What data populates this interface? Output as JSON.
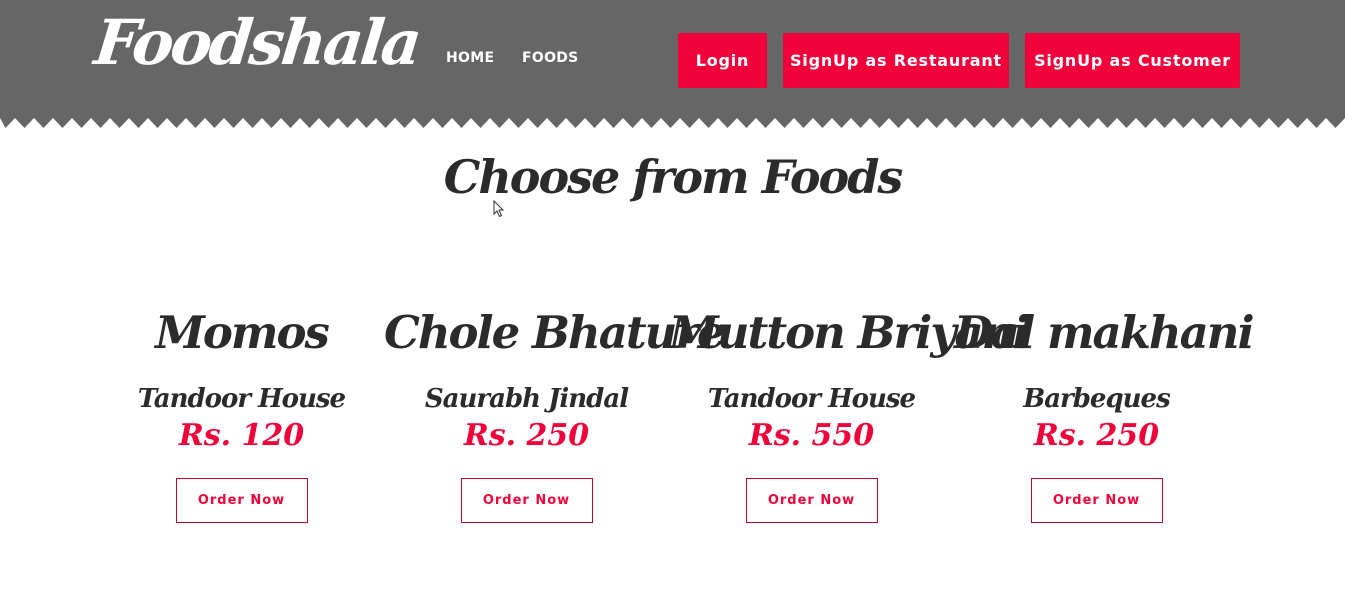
{
  "brand": {
    "logo_text": "Foodshala"
  },
  "nav": {
    "home_label": "HOME",
    "foods_label": "FOODS"
  },
  "header_buttons": {
    "login_label": "Login",
    "signup_restaurant_label": "SignUp as Restaurant",
    "signup_customer_label": "SignUp as Customer"
  },
  "colors": {
    "header_bg": "#666666",
    "accent": "#f0033a",
    "text_dark": "#2b2b2b"
  },
  "section": {
    "title": "Choose from Foods"
  },
  "foods": [
    {
      "name": "Momos",
      "restaurant": "Tandoor House",
      "price": "Rs. 120",
      "order_label": "Order Now"
    },
    {
      "name": "Chole Bhature",
      "restaurant": "Saurabh Jindal",
      "price": "Rs. 250",
      "order_label": "Order Now"
    },
    {
      "name": "Mutton Briyani",
      "restaurant": "Tandoor House",
      "price": "Rs. 550",
      "order_label": "Order Now"
    },
    {
      "name": "Dal makhani",
      "restaurant": "Barbeques",
      "price": "Rs. 250",
      "order_label": "Order Now"
    }
  ]
}
